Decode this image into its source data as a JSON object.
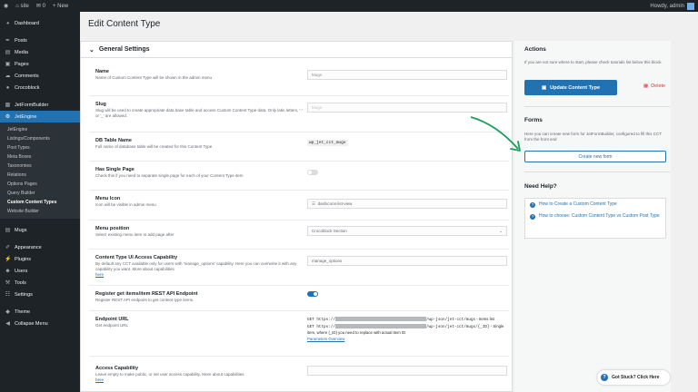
{
  "adminbar": {
    "site": "site",
    "comments": "0",
    "new_label": "New",
    "howdy": "Howdy, admin"
  },
  "sidebar": {
    "items": [
      {
        "label": "Dashboard",
        "icon": "dashboard-icon"
      },
      {
        "label": "Posts",
        "icon": "pin-icon"
      },
      {
        "label": "Media",
        "icon": "media-icon"
      },
      {
        "label": "Pages",
        "icon": "page-icon"
      },
      {
        "label": "Comments",
        "icon": "comment-icon"
      },
      {
        "label": "Crocoblock",
        "icon": "crocoblock-icon"
      },
      {
        "label": "JetFormBuilder",
        "icon": "form-icon"
      },
      {
        "label": "JetEngine",
        "icon": "engine-icon"
      }
    ],
    "sub": [
      "JetEngine",
      "Listings/Components",
      "Post Types",
      "Meta Boxes",
      "Taxonomies",
      "Relations",
      "Options Pages",
      "Query Builder",
      "Custom Content Types",
      "Website Builder"
    ],
    "items2": [
      {
        "label": "Mugs",
        "icon": "mug-icon"
      },
      {
        "label": "Appearance",
        "icon": "brush-icon"
      },
      {
        "label": "Plugins",
        "icon": "plugin-icon"
      },
      {
        "label": "Users",
        "icon": "user-icon"
      },
      {
        "label": "Tools",
        "icon": "wrench-icon"
      },
      {
        "label": "Settings",
        "icon": "settings-icon"
      },
      {
        "label": "Theme",
        "icon": "theme-icon"
      },
      {
        "label": "Collapse Menu",
        "icon": "collapse-icon"
      }
    ]
  },
  "page": {
    "title": "Edit Content Type",
    "section": "General Settings"
  },
  "fields": {
    "name": {
      "label": "Name",
      "desc": "Name of Custom Content Type will be shown in the admin menu",
      "value": "Mugs"
    },
    "slug": {
      "label": "Slug",
      "desc": "Slug will be used to create appropriate data base table and access Custom Content Type data. Only latin letters, '-' or '_' are allowed.",
      "value": "Mugs"
    },
    "table": {
      "label": "DB Table Name",
      "desc": "Full name of database table will be created for this Content Type",
      "value": "wp_jet_cct_mugs"
    },
    "single": {
      "label": "Has Single Page",
      "desc": "Check this if you need to separate single page for each of your Content Type item"
    },
    "icon": {
      "label": "Menu Icon",
      "desc": "Icon will be visible in admin menu",
      "value": "dashicons-list-view"
    },
    "position": {
      "label": "Menu position",
      "desc": "Select existing menu item to add page after",
      "value": "Crocoblock Section"
    },
    "access": {
      "label": "Content Type UI Access Capability",
      "desc": "By default any CCT available only for users with 'manage_options' capability. Here you can overwrite it with any capability you want. More about capabilities",
      "link": "here",
      "value": "manage_options"
    },
    "rest": {
      "label": "Register get items/item REST API Endpoint",
      "desc": "Register REST API endpoint to get content type items."
    },
    "endpoint": {
      "label": "Endpoint URL",
      "desc": "Get endpoint URL",
      "line1_pre": "GET https://",
      "line1_post": "/wp-json/jet-cct/mugs",
      "line1_note": " - Items list",
      "line2_pre": "GET https://",
      "line2_post": "/wp-json/jet-cct/mugs/{_ID}",
      "line2_note": " - Single item, where {_ID} you need to replace with actual item ID",
      "link": "Parameters Overview"
    },
    "cap": {
      "label": "Access Capability",
      "desc": "Leave empty to make public, or set user access capability. More about capabilities",
      "link": "here"
    }
  },
  "actions": {
    "heading": "Actions",
    "desc": "If you are not sure where to start, please check tutorials list below this block.",
    "update": "Update Content Type",
    "delete": "Delete"
  },
  "forms": {
    "heading": "Forms",
    "desc": "Here you can create new form for JetFormBuilder, configured to fill this CCT from the front end",
    "button": "Create new form"
  },
  "help": {
    "heading": "Need Help?",
    "links": [
      "How to Create a Custom Content Type",
      "How to choose: Custom Content Type vs Custom Post Type"
    ],
    "stuck": "Got Stuck? Click Here"
  },
  "colors": {
    "accent": "#2271b1",
    "arrow": "#1a9e5c",
    "danger": "#d63638"
  }
}
